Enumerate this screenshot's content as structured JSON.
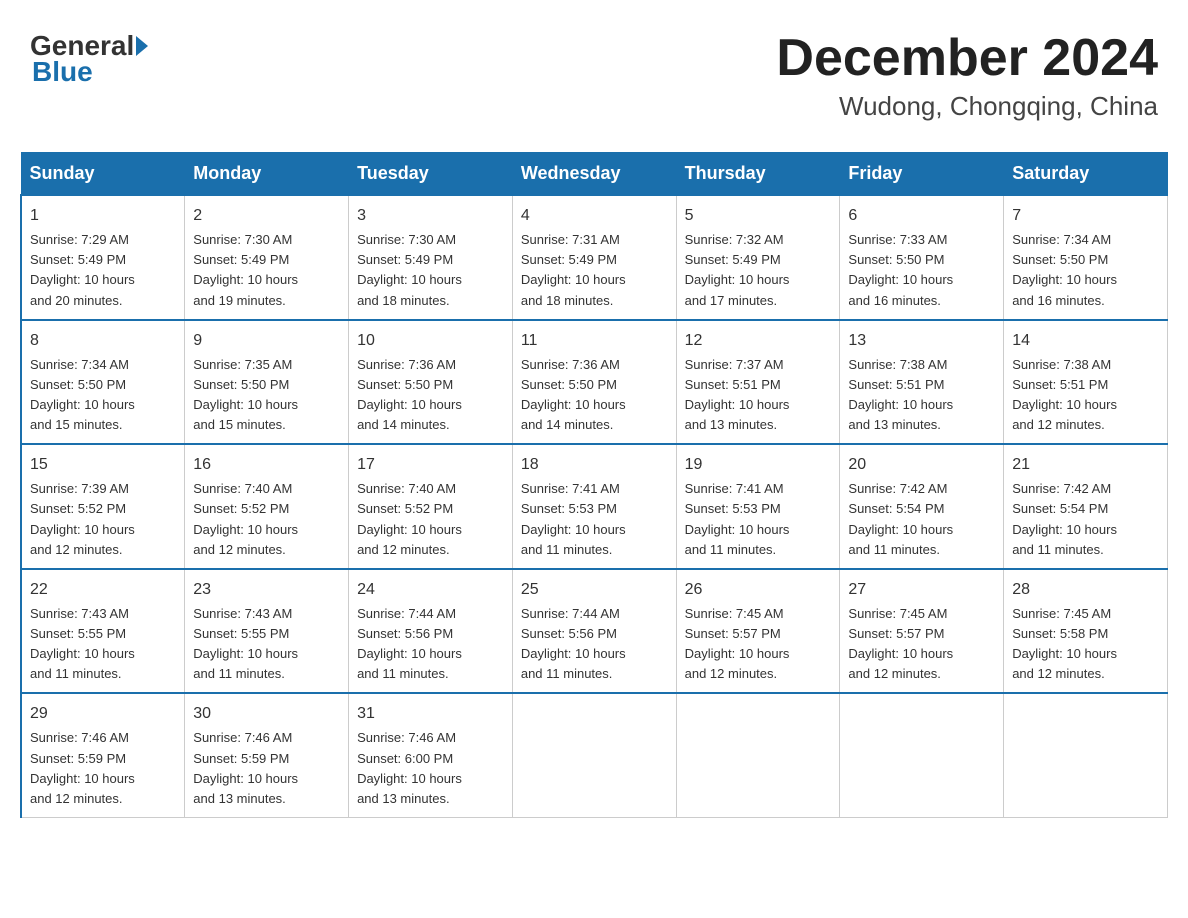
{
  "header": {
    "logo_general": "General",
    "logo_blue": "Blue",
    "title": "December 2024",
    "subtitle": "Wudong, Chongqing, China"
  },
  "weekdays": [
    "Sunday",
    "Monday",
    "Tuesday",
    "Wednesday",
    "Thursday",
    "Friday",
    "Saturday"
  ],
  "weeks": [
    [
      {
        "day": "1",
        "sunrise": "7:29 AM",
        "sunset": "5:49 PM",
        "daylight": "10 hours and 20 minutes."
      },
      {
        "day": "2",
        "sunrise": "7:30 AM",
        "sunset": "5:49 PM",
        "daylight": "10 hours and 19 minutes."
      },
      {
        "day": "3",
        "sunrise": "7:30 AM",
        "sunset": "5:49 PM",
        "daylight": "10 hours and 18 minutes."
      },
      {
        "day": "4",
        "sunrise": "7:31 AM",
        "sunset": "5:49 PM",
        "daylight": "10 hours and 18 minutes."
      },
      {
        "day": "5",
        "sunrise": "7:32 AM",
        "sunset": "5:49 PM",
        "daylight": "10 hours and 17 minutes."
      },
      {
        "day": "6",
        "sunrise": "7:33 AM",
        "sunset": "5:50 PM",
        "daylight": "10 hours and 16 minutes."
      },
      {
        "day": "7",
        "sunrise": "7:34 AM",
        "sunset": "5:50 PM",
        "daylight": "10 hours and 16 minutes."
      }
    ],
    [
      {
        "day": "8",
        "sunrise": "7:34 AM",
        "sunset": "5:50 PM",
        "daylight": "10 hours and 15 minutes."
      },
      {
        "day": "9",
        "sunrise": "7:35 AM",
        "sunset": "5:50 PM",
        "daylight": "10 hours and 15 minutes."
      },
      {
        "day": "10",
        "sunrise": "7:36 AM",
        "sunset": "5:50 PM",
        "daylight": "10 hours and 14 minutes."
      },
      {
        "day": "11",
        "sunrise": "7:36 AM",
        "sunset": "5:50 PM",
        "daylight": "10 hours and 14 minutes."
      },
      {
        "day": "12",
        "sunrise": "7:37 AM",
        "sunset": "5:51 PM",
        "daylight": "10 hours and 13 minutes."
      },
      {
        "day": "13",
        "sunrise": "7:38 AM",
        "sunset": "5:51 PM",
        "daylight": "10 hours and 13 minutes."
      },
      {
        "day": "14",
        "sunrise": "7:38 AM",
        "sunset": "5:51 PM",
        "daylight": "10 hours and 12 minutes."
      }
    ],
    [
      {
        "day": "15",
        "sunrise": "7:39 AM",
        "sunset": "5:52 PM",
        "daylight": "10 hours and 12 minutes."
      },
      {
        "day": "16",
        "sunrise": "7:40 AM",
        "sunset": "5:52 PM",
        "daylight": "10 hours and 12 minutes."
      },
      {
        "day": "17",
        "sunrise": "7:40 AM",
        "sunset": "5:52 PM",
        "daylight": "10 hours and 12 minutes."
      },
      {
        "day": "18",
        "sunrise": "7:41 AM",
        "sunset": "5:53 PM",
        "daylight": "10 hours and 11 minutes."
      },
      {
        "day": "19",
        "sunrise": "7:41 AM",
        "sunset": "5:53 PM",
        "daylight": "10 hours and 11 minutes."
      },
      {
        "day": "20",
        "sunrise": "7:42 AM",
        "sunset": "5:54 PM",
        "daylight": "10 hours and 11 minutes."
      },
      {
        "day": "21",
        "sunrise": "7:42 AM",
        "sunset": "5:54 PM",
        "daylight": "10 hours and 11 minutes."
      }
    ],
    [
      {
        "day": "22",
        "sunrise": "7:43 AM",
        "sunset": "5:55 PM",
        "daylight": "10 hours and 11 minutes."
      },
      {
        "day": "23",
        "sunrise": "7:43 AM",
        "sunset": "5:55 PM",
        "daylight": "10 hours and 11 minutes."
      },
      {
        "day": "24",
        "sunrise": "7:44 AM",
        "sunset": "5:56 PM",
        "daylight": "10 hours and 11 minutes."
      },
      {
        "day": "25",
        "sunrise": "7:44 AM",
        "sunset": "5:56 PM",
        "daylight": "10 hours and 11 minutes."
      },
      {
        "day": "26",
        "sunrise": "7:45 AM",
        "sunset": "5:57 PM",
        "daylight": "10 hours and 12 minutes."
      },
      {
        "day": "27",
        "sunrise": "7:45 AM",
        "sunset": "5:57 PM",
        "daylight": "10 hours and 12 minutes."
      },
      {
        "day": "28",
        "sunrise": "7:45 AM",
        "sunset": "5:58 PM",
        "daylight": "10 hours and 12 minutes."
      }
    ],
    [
      {
        "day": "29",
        "sunrise": "7:46 AM",
        "sunset": "5:59 PM",
        "daylight": "10 hours and 12 minutes."
      },
      {
        "day": "30",
        "sunrise": "7:46 AM",
        "sunset": "5:59 PM",
        "daylight": "10 hours and 13 minutes."
      },
      {
        "day": "31",
        "sunrise": "7:46 AM",
        "sunset": "6:00 PM",
        "daylight": "10 hours and 13 minutes."
      },
      null,
      null,
      null,
      null
    ]
  ],
  "labels": {
    "sunrise_prefix": "Sunrise: ",
    "sunset_prefix": "Sunset: ",
    "daylight_prefix": "Daylight: "
  }
}
